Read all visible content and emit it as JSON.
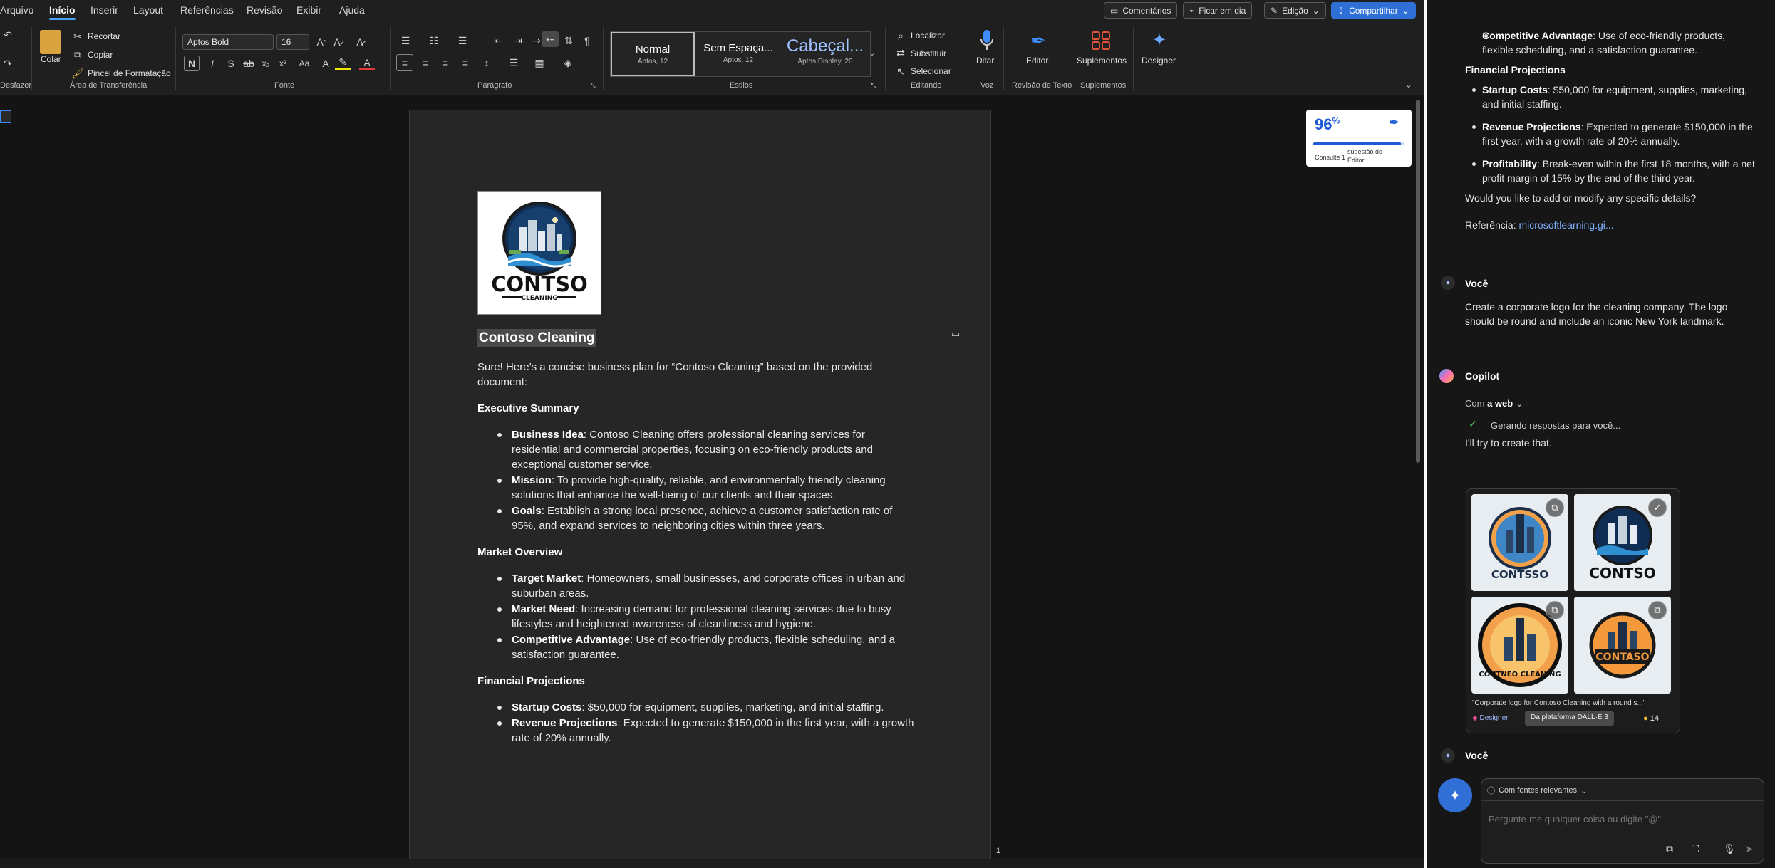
{
  "menubar": {
    "tabs": [
      "Arquivo",
      "Início",
      "Inserir",
      "Layout",
      "Referências",
      "Revisão",
      "Exibir",
      "Ajuda"
    ],
    "active_tab": "Início",
    "comments": "Comentários",
    "catch_up": "Ficar em dia",
    "editing": "Edição",
    "share": "Compartilhar"
  },
  "ribbon": {
    "undo_label": "Desfazer",
    "clipboard": {
      "paste": "Colar",
      "cut": "Recortar",
      "copy": "Copiar",
      "format_painter": "Pincel de Formatação",
      "group": "Área de Transferência"
    },
    "font": {
      "name": "Aptos Bold",
      "size": "16",
      "group": "Fonte",
      "bold": "N",
      "italic": "I",
      "underline": "S"
    },
    "paragraph": {
      "group": "Parágrafo"
    },
    "styles": {
      "group": "Estilos",
      "items": [
        {
          "name": "Normal",
          "sub": "Aptos, 12"
        },
        {
          "name": "Sem Espaça...",
          "sub": "Aptos, 12"
        },
        {
          "name": "Cabeçal...",
          "sub": "Aptos Display, 20"
        }
      ]
    },
    "editing": {
      "find": "Localizar",
      "replace": "Substituir",
      "select": "Selecionar",
      "group": "Editando"
    },
    "voice": {
      "dictate": "Ditar",
      "group": "Voz"
    },
    "editor": {
      "label": "Editor",
      "group": "Revisão de Texto"
    },
    "addins": {
      "label": "Suplementos",
      "group": "Suplementos"
    },
    "designer": {
      "label": "Designer"
    }
  },
  "editor_score": {
    "value": "96",
    "suffix": "%",
    "caption_a": "Consulte 1",
    "caption_b": "sugestão do",
    "caption_c": "Editor"
  },
  "document": {
    "logo": {
      "word": "CONTSO",
      "subword": "CLEANING"
    },
    "title": "Contoso Cleaning",
    "intro_1": "Sure! Here’s a concise business plan for “Contoso Cleaning” based on the provided",
    "intro_2": "document:",
    "sec1": "Executive Summary",
    "b1_label": "Business Idea",
    "b1_l1": ": Contoso Cleaning offers professional cleaning services for",
    "b1_l2": "residential and commercial properties, focusing on eco-friendly products and",
    "b1_l3": "exceptional customer service.",
    "b2_label": "Mission",
    "b2_l1": ": To provide high-quality, reliable, and environmentally friendly cleaning",
    "b2_l2": "solutions that enhance the well-being of our clients and their spaces.",
    "b3_label": "Goals",
    "b3_l1": ": Establish a strong local presence, achieve a customer satisfaction rate of",
    "b3_l2": "95%, and expand services to neighboring cities within three years.",
    "sec2": "Market Overview",
    "b4_label": "Target Market",
    "b4_l1": ": Homeowners, small businesses, and corporate offices in urban and",
    "b4_l2": "suburban areas.",
    "b5_label": "Market Need",
    "b5_l1": ": Increasing demand for professional cleaning services due to busy",
    "b5_l2": "lifestyles and heightened awareness of cleanliness and hygiene.",
    "b6_label": "Competitive Advantage",
    "b6_l1": ": Use of eco-friendly products, flexible scheduling, and a",
    "b6_l2": "satisfaction guarantee.",
    "sec3": "Financial Projections",
    "b7_label": "Startup Costs",
    "b7_l1": ": $50,000 for equipment, supplies, marketing, and initial staffing.",
    "b8_label": "Revenue Projections",
    "b8_l1": ": Expected to generate $150,000 in the first year, with a growth",
    "b8_l2": "rate of 20% annually.",
    "page_number": "1"
  },
  "copilot": {
    "c1_label": "Competitive Advantage",
    "c1_l1": ": Use of eco-friendly products,",
    "c1_l2": "flexible scheduling, and a satisfaction guarantee.",
    "fin_heading": "Financial Projections",
    "c2_label": "Startup Costs",
    "c2_l1": ": $50,000 for equipment, supplies, marketing,",
    "c2_l2": "and initial staffing.",
    "c3_label": "Revenue Projections",
    "c3_l1": ": Expected to generate $150,000 in the",
    "c3_l2": "first year, with a growth rate of 20% annually.",
    "c4_label": "Profitability",
    "c4_l1": ": Break-even within the first 18 months, with a net",
    "c4_l2": "profit margin of 15% by the end of the third year.",
    "followup": "Would you like to add or modify any specific details?",
    "ref_label": "Referência:",
    "ref_link": "microsoftlearning.gi...",
    "you_label": "Você",
    "user_msg_l1": "Create a corporate logo for the cleaning company. The logo",
    "user_msg_l2": "should be round and include an iconic New York landmark.",
    "copilot_label": "Copilot",
    "with_prefix": "Com",
    "with_web": "a web",
    "generating": "Gerando respostas para você...",
    "try_text": "I'll try to create that.",
    "thumb_words": [
      "CONTSSO",
      "CONTSO",
      "CONTNEO CLEANING",
      "CONTASO"
    ],
    "caption": "\"Corporate logo for Contoso Cleaning with a round s...\"",
    "designer_label": "Designer",
    "platform": "Da plataforma DALL·E 3",
    "boosts": "14",
    "you_label_2": "Você",
    "sources_chip": "Com fontes relevantes",
    "input_placeholder": "Pergunte-me qualquer coisa ou digite \"@\""
  },
  "colors": {
    "accent": "#4aa3ff",
    "share": "#2f6fd6",
    "page": "#262626"
  }
}
